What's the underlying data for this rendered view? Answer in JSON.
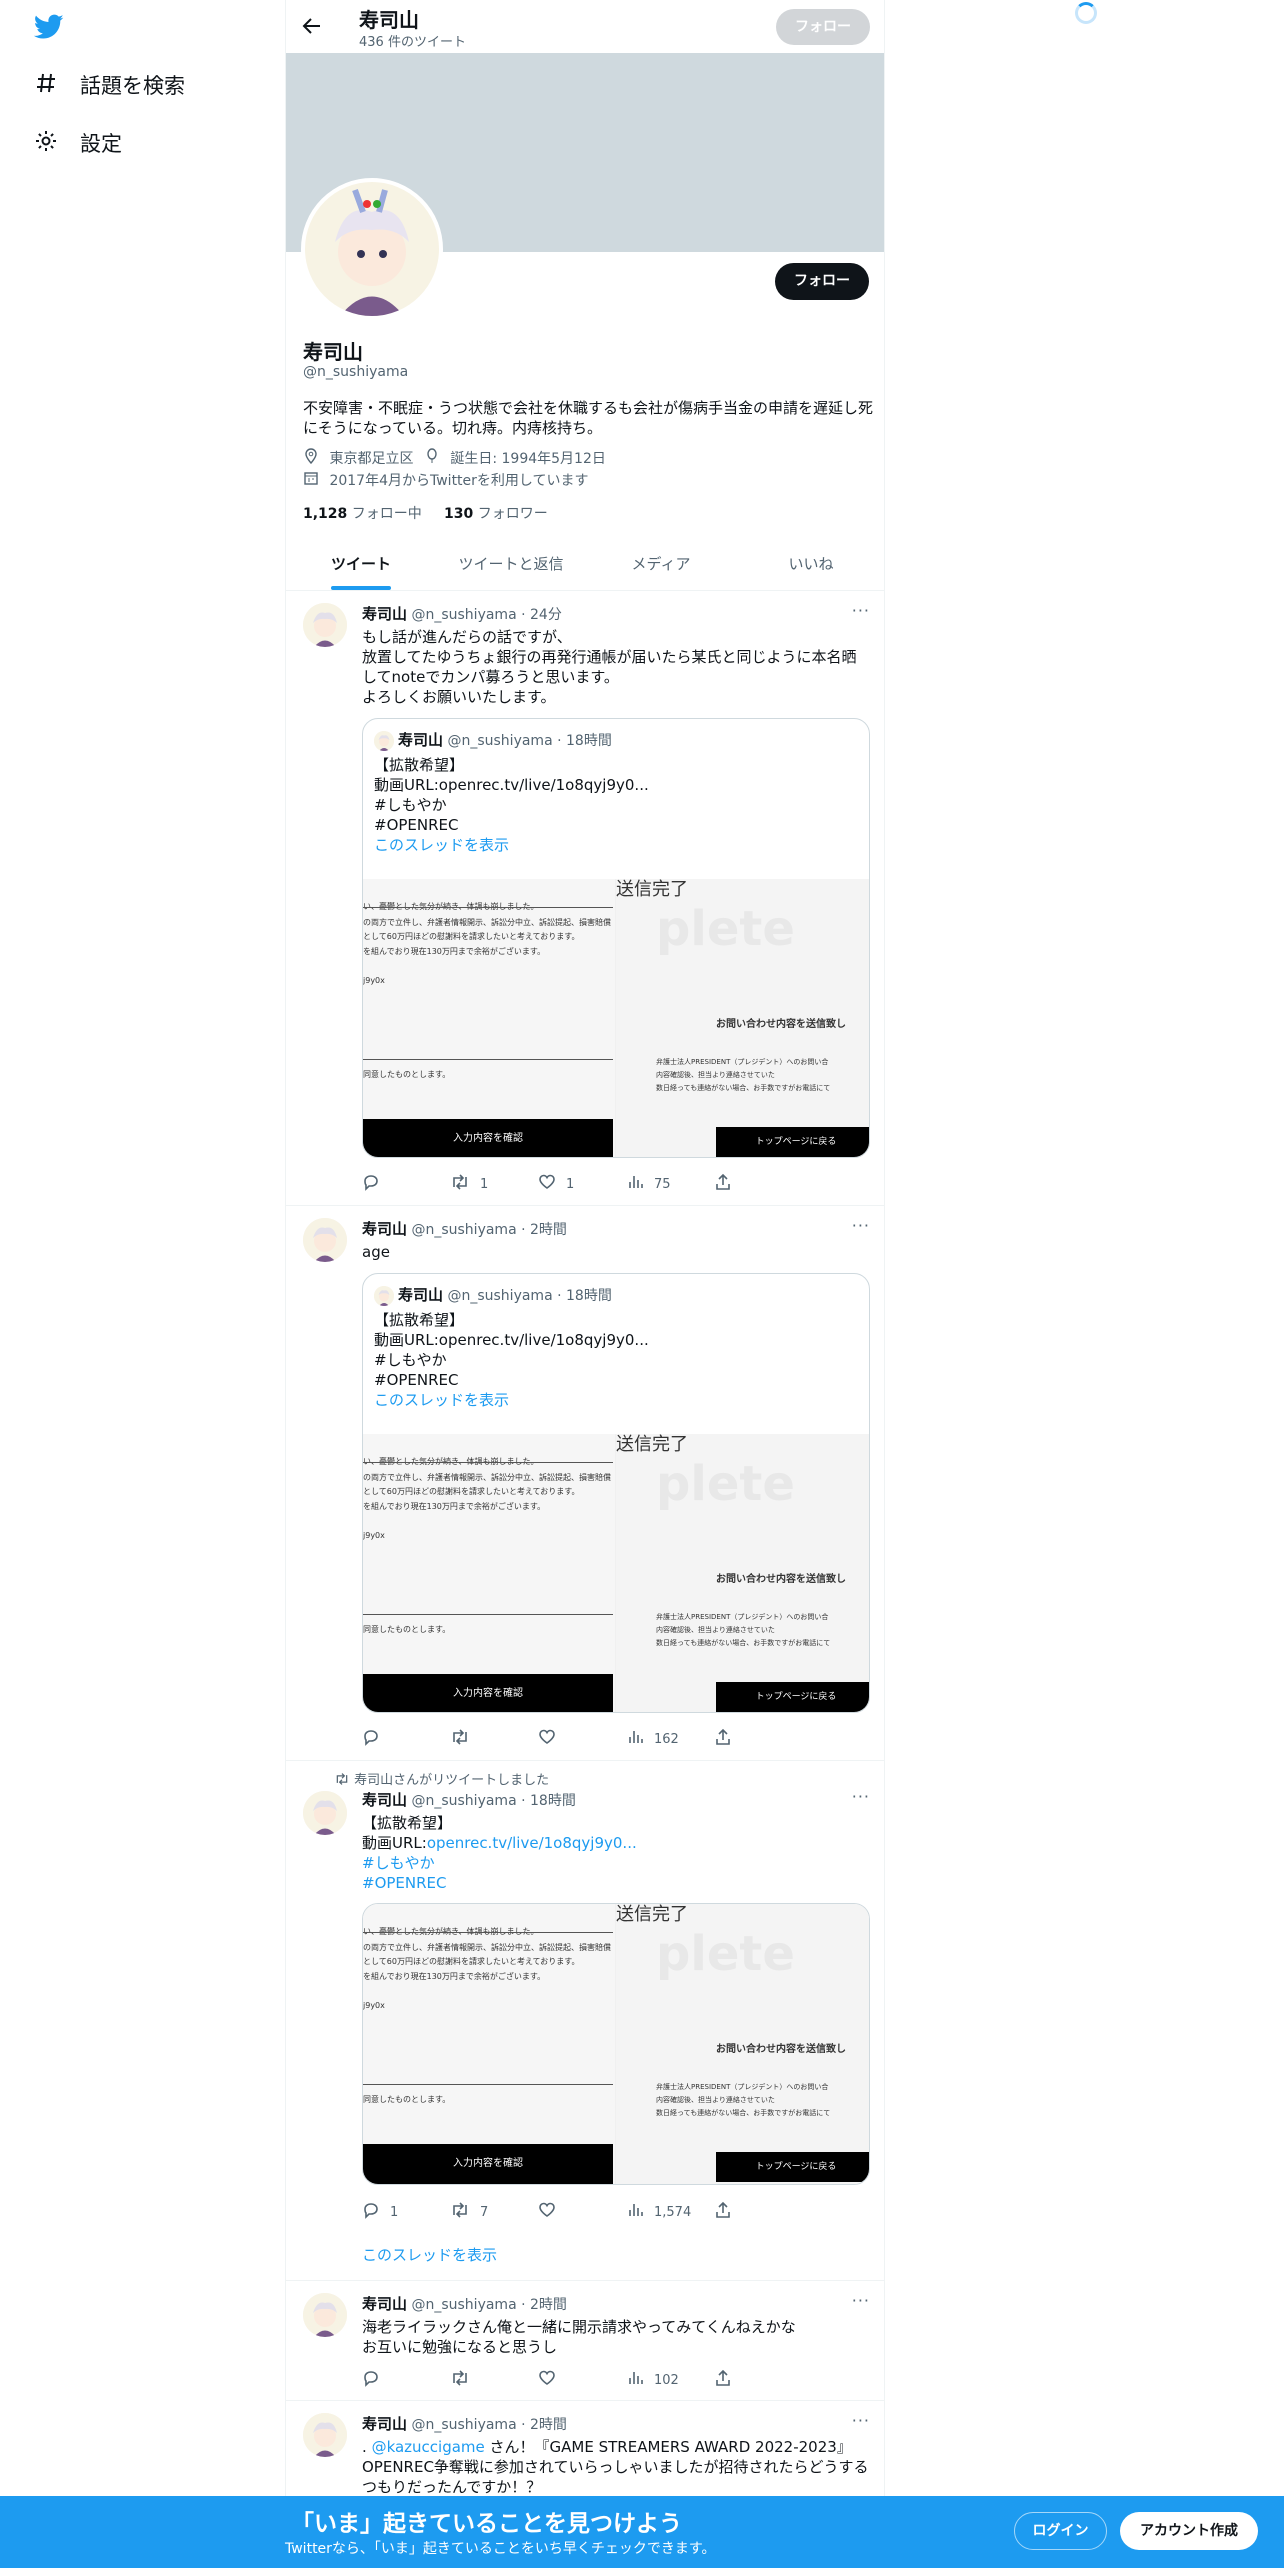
{
  "nav": {
    "items": [
      {
        "label": "話題を検索",
        "icon": "hash-icon"
      },
      {
        "label": "設定",
        "icon": "gear-icon"
      }
    ]
  },
  "header": {
    "name": "寿司山",
    "tweet_count": "436 件のツイート",
    "follow_label": "フォロー"
  },
  "profile": {
    "follow_label": "フォロー",
    "name": "寿司山",
    "handle": "@n_sushiyama",
    "bio": "不安障害・不眠症・うつ状態で会社を休職するも会社が傷病手当金の申請を遅延し死にそうになっている。切れ痔。内痔核持ち。",
    "location": "東京都足立区",
    "birthday": "誕生日: 1994年5月12日",
    "joined": "2017年4月からTwitterを利用しています",
    "following_count": "1,128",
    "following_label": "フォロー中",
    "followers_count": "130",
    "followers_label": "フォロワー"
  },
  "tabs": [
    "ツイート",
    "ツイートと返信",
    "メディア",
    "いいね"
  ],
  "quote": {
    "name": "寿司山",
    "handle": "@n_sushiyama",
    "time": "18時間",
    "lines": [
      "【拡散希望】",
      "動画URL:openrec.tv/live/1o8qyj9y0...",
      "#しもやか",
      "#OPENREC"
    ],
    "thread_link": "このスレッドを表示"
  },
  "media": {
    "left_lines": [
      "い、憂鬱とした気分が続き、体調も崩しました。",
      "の両方で立件し、弁護者情報開示、訴訟分中立、訴訟提起、損害賠償",
      "として60万円ほどの慰謝料を請求したいと考えております。",
      "を組んでおり現在130万円まで余裕がございます。",
      "j9y0x",
      "同意したものとします。"
    ],
    "left_button": "入力内容を確認",
    "right_title": "送信完了",
    "right_watermark": "plete",
    "right_heading": "お問い合わせ内容を送信致し",
    "right_lines": [
      "弁護士法人PRESIDENT（プレジデント）へのお問い合",
      "内容確認後、担当より連絡させていた",
      "数日経っても連絡がない場合、お手数ですがお電話にて"
    ],
    "right_button": "トップページに戻る"
  },
  "tweets": [
    {
      "name": "寿司山",
      "handle": "@n_sushiyama",
      "time": "24分",
      "more": "···",
      "text": "もし話が進んだらの話ですが、\n放置してたゆうちょ銀行の再発行通帳が届いたら某氏と同じように本名晒してnoteでカンパ募ろうと思います。\nよろしくお願いいたします。",
      "reply": "",
      "retweet": "1",
      "like": "1",
      "views": "75"
    },
    {
      "name": "寿司山",
      "handle": "@n_sushiyama",
      "time": "2時間",
      "more": "···",
      "text": "age",
      "reply": "",
      "retweet": "",
      "like": "",
      "views": "162"
    },
    {
      "rt_label": "寿司山さんがリツイートしました",
      "name": "寿司山",
      "handle": "@n_sushiyama",
      "time": "18時間",
      "more": "···",
      "line1": "【拡散希望】",
      "url_prefix": "動画URL:",
      "url": "openrec.tv/live/1o8qyj9y0...",
      "tag1": "#しもやか",
      "tag2": "#OPENREC",
      "reply": "1",
      "retweet": "7",
      "like": "",
      "views": "1,574",
      "thread_link": "このスレッドを表示"
    },
    {
      "name": "寿司山",
      "handle": "@n_sushiyama",
      "time": "2時間",
      "more": "···",
      "text": "海老ライラックさん俺と一緒に開示請求やってみてくんねえかな\nお互いに勉強になると思うし",
      "reply": "",
      "retweet": "",
      "like": "",
      "views": "102"
    },
    {
      "name": "寿司山",
      "handle": "@n_sushiyama",
      "time": "2時間",
      "more": "···",
      "prefix": ".",
      "mention": "@kazuccigame",
      "text": " さん！『GAME STREAMERS AWARD 2022-2023』OPENREC争奪戦に参加されていらっしゃいましたが招待されたらどうするつもりだったんですか！？"
    }
  ],
  "bottom": {
    "title": "「いま」起きていることを見つけよう",
    "subtitle": "Twitterなら、「いま」起きていることをいち早くチェックできます。",
    "login": "ログイン",
    "signup": "アカウント作成"
  },
  "colors": {
    "accent": "#1d9bf0",
    "text": "#0f1419",
    "muted": "#536471",
    "banner": "#cfd9de"
  }
}
